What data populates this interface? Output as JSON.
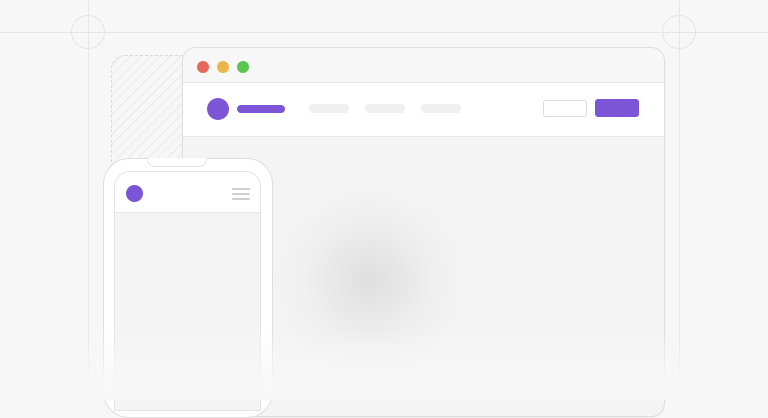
{
  "colors": {
    "accent": "#7b55d6",
    "traffic_close": "#e8675a",
    "traffic_minimize": "#eab64a",
    "traffic_maximize": "#5cc453"
  },
  "browser": {
    "window_controls": [
      "close",
      "minimize",
      "maximize"
    ],
    "navbar": {
      "logo_icon": "purple-circle-logo",
      "links_placeholder": [
        "",
        "",
        ""
      ],
      "buttons": [
        "",
        ""
      ]
    }
  },
  "phone": {
    "header": {
      "logo_icon": "purple-circle-logo",
      "menu_icon": "hamburger-menu-icon"
    }
  }
}
